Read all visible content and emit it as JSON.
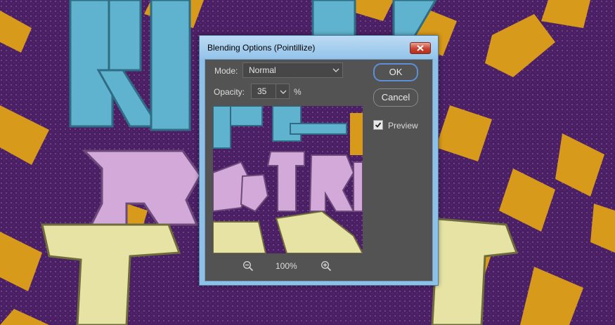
{
  "dialog": {
    "title": "Blending Options (Pointillize)",
    "mode_label": "Mode:",
    "mode_value": "Normal",
    "opacity_label": "Opacity:",
    "opacity_value": "35",
    "opacity_unit": "%",
    "ok_label": "OK",
    "cancel_label": "Cancel",
    "preview_label": "Preview",
    "preview_checked": true,
    "zoom_level": "100%"
  },
  "artwork": {
    "word_top": "REALLY",
    "word_middle": "ReTRo",
    "word_bottom": "TEXT"
  },
  "colors": {
    "background_purple": "#4a1f63",
    "accent_orange": "#d89a1a",
    "text_blue": "#5fb3cf",
    "text_pink": "#d2a9d8",
    "text_cream": "#e6e3a4",
    "dialog_gray": "#535353",
    "ok_focus_ring": "#5d8fd8"
  }
}
